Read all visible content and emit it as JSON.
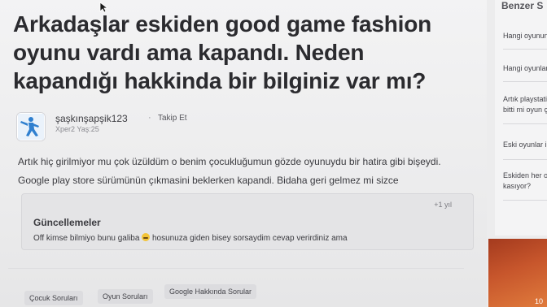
{
  "question": {
    "title": "Arkadaşlar eskiden good game fashion oyunu vardı ama kapandı. Neden kapandığı hakkinda bir bilginiz var mı?",
    "author": {
      "name": "şaşkınşapşik123",
      "separator": "·",
      "follow_label": "Takip Et",
      "meta": "Xper2 Yaş:25"
    },
    "body": "Artık hiç girilmiyor mu çok üzüldüm o benim çocukluğumun gözde oyunuydu bir hatira gibi bişeydi. Google play store sürümünün çıkmasini beklerken kapandi. Bidaha geri gelmez mi sizce"
  },
  "updates": {
    "time": "+1 yıl",
    "title": "Güncellemeler",
    "text_before": "Off kimse bilmiyo bunu galiba",
    "emoji": "sad-face-emoji-icon",
    "text_after": "hosunuza giden bisey sorsaydim cevap verirdiniz ama"
  },
  "tags": [
    "Çocuk Soruları",
    "Oyun Soruları",
    "Google Hakkında Sorular"
  ],
  "sidebar": {
    "title": "Benzer S",
    "items": [
      "Hangi oyunun",
      "Hangi oyunlar",
      "Artık playstati\nbitti mi oyun ç",
      "Eski oyunlar il",
      "Eskiden her oy\nkasıyor?"
    ],
    "ad_number": "10"
  },
  "colors": {
    "title": "#2b2b2f",
    "body": "#3a3a3f",
    "ad": "#c7562c"
  }
}
